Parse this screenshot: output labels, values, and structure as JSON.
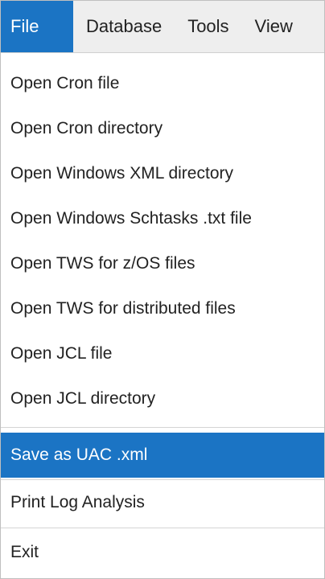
{
  "menubar": {
    "items": [
      {
        "label": "File",
        "active": true
      },
      {
        "label": "Database",
        "active": false
      },
      {
        "label": "Tools",
        "active": false
      },
      {
        "label": "View",
        "active": false
      }
    ]
  },
  "file_menu": {
    "items": [
      {
        "label": "Open Cron file"
      },
      {
        "label": "Open Cron directory"
      },
      {
        "label": "Open Windows XML directory"
      },
      {
        "label": "Open Windows Schtasks .txt file"
      },
      {
        "label": "Open TWS for z/OS files"
      },
      {
        "label": "Open TWS for distributed files"
      },
      {
        "label": "Open JCL file"
      },
      {
        "label": "Open JCL directory"
      },
      {
        "label": "Save as UAC .xml",
        "highlighted": true
      },
      {
        "label": "Print Log Analysis"
      },
      {
        "label": "Exit"
      }
    ]
  },
  "colors": {
    "accent": "#1b74c4",
    "menubar_bg": "#eeeeee",
    "menu_bg": "#ffffff",
    "text": "#222222"
  }
}
